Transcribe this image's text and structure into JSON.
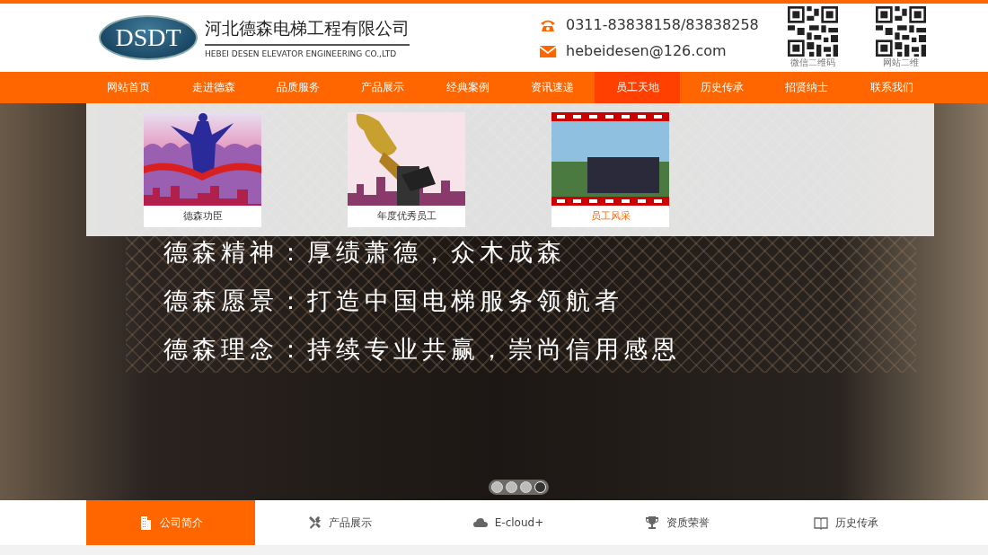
{
  "header": {
    "logo_mark": "DSDT",
    "company_name": "河北德森电梯工程有限公司",
    "company_name_en": "HEBEI DESEN ELEVATOR ENGINEERING CO.,LTD",
    "phone": "0311-83838158/83838258",
    "email": "hebeidesen@126.com",
    "qr_codes": [
      {
        "caption": "微信二维码"
      },
      {
        "caption": "网站二维"
      }
    ]
  },
  "nav": [
    {
      "label": "网站首页",
      "selected": false
    },
    {
      "label": "走进德森",
      "selected": false
    },
    {
      "label": "品质服务",
      "selected": false
    },
    {
      "label": "产品展示",
      "selected": false
    },
    {
      "label": "经典案例",
      "selected": false
    },
    {
      "label": "资讯速递",
      "selected": false
    },
    {
      "label": "员工天地",
      "selected": true
    },
    {
      "label": "历史传承",
      "selected": false
    },
    {
      "label": "招贤纳士",
      "selected": false
    },
    {
      "label": "联系我们",
      "selected": false
    }
  ],
  "dropdown": [
    {
      "kind": "runners",
      "caption": "德森功臣",
      "selected": false
    },
    {
      "kind": "trophy",
      "caption": "年度优秀员工",
      "selected": false
    },
    {
      "kind": "film",
      "caption": "员工风采",
      "selected": true
    }
  ],
  "banner": {
    "slogans": [
      "德森精神：厚绩萧德，众木成森",
      "德森愿景：打造中国电梯服务领航者",
      "德森理念：持续专业共赢，崇尚信用感恩"
    ],
    "dots": [
      {
        "selected": false
      },
      {
        "selected": false
      },
      {
        "selected": false
      },
      {
        "selected": true
      }
    ]
  },
  "bottom_tabs": [
    {
      "kind": "building",
      "label": "公司简介",
      "selected": true
    },
    {
      "kind": "tools",
      "label": "产品展示",
      "selected": false
    },
    {
      "kind": "cloud",
      "label": "E-cloud+",
      "selected": false
    },
    {
      "kind": "trophy",
      "label": "资质荣誉",
      "selected": false
    },
    {
      "kind": "book",
      "label": "历史传承",
      "selected": false
    }
  ]
}
